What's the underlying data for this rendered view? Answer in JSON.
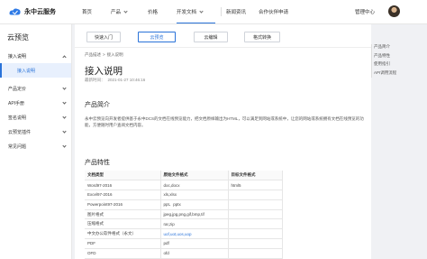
{
  "header": {
    "brand_name": "永中云服务",
    "nav": [
      {
        "label": "首页",
        "has_dropdown": false,
        "active": false
      },
      {
        "label": "产品",
        "has_dropdown": true,
        "active": false
      },
      {
        "label": "价格",
        "has_dropdown": false,
        "active": false
      },
      {
        "label": "开发文档",
        "has_dropdown": true,
        "active": true
      },
      {
        "label": "新闻资讯",
        "has_dropdown": false,
        "active": false
      },
      {
        "label": "合作伙伴申请",
        "has_dropdown": false,
        "active": false
      }
    ],
    "admin_label": "管理中心"
  },
  "sidebar": {
    "title": "云预览",
    "items": [
      {
        "label": "接入说明",
        "expanded": true
      },
      {
        "label": "接入说明",
        "selected": true
      },
      {
        "label": "产品定价"
      },
      {
        "label": "API手册"
      },
      {
        "label": "签名说明"
      },
      {
        "label": "云预览插件"
      },
      {
        "label": "常见问题"
      }
    ]
  },
  "buttons": {
    "quick_start": "快速入门",
    "cloud_preview": "云预览",
    "cloud_edit": "云编辑",
    "format_convert": "格式转换"
  },
  "breadcrumb": {
    "root": "产品描述",
    "sep": ">",
    "current": "接入说明"
  },
  "article": {
    "title": "接入说明",
    "updated_label": "最新时间：",
    "updated_value": "2021-01-27 10:46:16",
    "section_intro": "产品简介",
    "intro_text": "永中云预览向开发者提供基于永中DCS的文档在线预览能力，把文档原样输出为HTML，可以满足到网站或系统中，让您的网站或系统拥有文档在线预览的功能，方便随时用户查阅文档内容。",
    "section_features": "产品特性"
  },
  "table": {
    "headers": [
      "文档类型",
      "原始文件格式",
      "目标文件格式"
    ],
    "rows": [
      {
        "type": "Word97-2016",
        "source": "doc,docx",
        "target": "html5"
      },
      {
        "type": "Excel97-2016",
        "source": "xls,xlsx",
        "target": ""
      },
      {
        "type": "Powerpoint97-2016",
        "source": "ppt、pptx",
        "target": ""
      },
      {
        "type": "图片格式",
        "source": "jpeg,jpg,png,gif,bmp,tif",
        "target": ""
      },
      {
        "type": "压缩格式",
        "source": "rar,zip",
        "target": ""
      },
      {
        "type": "中文办公软件格式（永文）",
        "source": "uof,uot,uos,uop",
        "target": ""
      },
      {
        "type": "PDF",
        "source": "pdf",
        "target": ""
      },
      {
        "type": "OFD",
        "source": "ofd",
        "target": ""
      }
    ]
  },
  "toc": [
    "产品简介",
    "产品特性",
    "使用指引",
    "API调用流程"
  ],
  "colors": {
    "accent": "#2a73d9",
    "background": "#f0f1f4",
    "selected_bg": "#e8f0fd"
  }
}
